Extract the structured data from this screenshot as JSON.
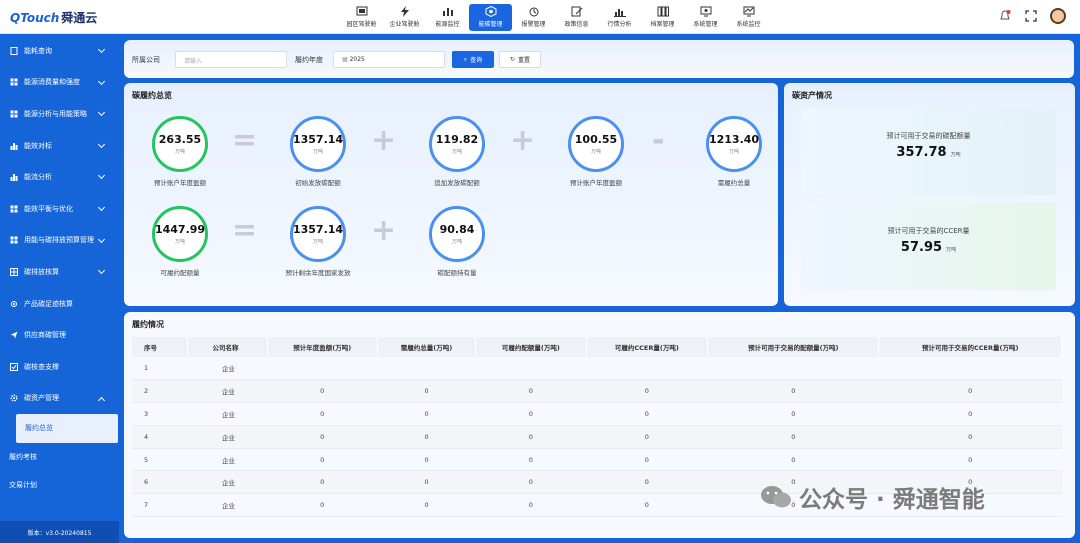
{
  "app": {
    "logo_en": "QTouch",
    "logo_cn": "舜通云"
  },
  "topnav": [
    {
      "label": "园区驾驶舱",
      "icon": "dashboard-icon"
    },
    {
      "label": "企业驾驶舱",
      "icon": "lightning-icon"
    },
    {
      "label": "能源监控",
      "icon": "bar-chart-icon"
    },
    {
      "label": "能碳管理",
      "icon": "carbon-icon"
    },
    {
      "label": "报警管理",
      "icon": "alarm-icon"
    },
    {
      "label": "政策信息",
      "icon": "edit-icon"
    },
    {
      "label": "行情分析",
      "icon": "market-chart-icon"
    },
    {
      "label": "档案管理",
      "icon": "archive-icon"
    },
    {
      "label": "系统管理",
      "icon": "monitor-icon"
    },
    {
      "label": "系统监控",
      "icon": "monitor-chart-icon"
    }
  ],
  "sidebar": {
    "items": [
      {
        "label": "能耗查询"
      },
      {
        "label": "能源消费量和强度"
      },
      {
        "label": "能源分析与用能策略"
      },
      {
        "label": "能效对标"
      },
      {
        "label": "能流分析"
      },
      {
        "label": "能效平衡与优化"
      },
      {
        "label": "用能与碳排放预算管理"
      },
      {
        "label": "碳排放核算"
      },
      {
        "label": "产品碳足迹核算"
      },
      {
        "label": "供应商碳管理"
      },
      {
        "label": "碳核查支撑"
      },
      {
        "label": "碳资产管理"
      }
    ],
    "sub_items": [
      {
        "label": "履约总览"
      },
      {
        "label": "履约考核"
      },
      {
        "label": "交易计划"
      }
    ],
    "version": "版本：v3.0-20240815"
  },
  "filter": {
    "company_label": "所属公司",
    "company_placeholder": "请输入",
    "year_label": "履约年度",
    "year_value": "2025",
    "query_label": "查询",
    "reset_label": "重置"
  },
  "overview": {
    "title": "碳履约总览",
    "unit": "万吨",
    "row1": [
      {
        "value": "263.55",
        "label": "预计账户年度盈额"
      },
      {
        "value": "1357.14",
        "label": "初始发放碳配额"
      },
      {
        "value": "119.82",
        "label": "追加发放碳配额"
      },
      {
        "value": "100.55",
        "label": "预计账户年度盈额"
      },
      {
        "value": "1213.40",
        "label": "需履约总量"
      }
    ],
    "row2": [
      {
        "value": "1447.99",
        "label": "可履约配额量"
      },
      {
        "value": "1357.14",
        "label": "预计剩余年度国家发放"
      },
      {
        "value": "90.84",
        "label": "碳配额持有量"
      }
    ]
  },
  "assets": {
    "title": "碳资产情况",
    "tradable_quota_label": "预计可用于交易的碳配额量",
    "tradable_quota_value": "357.78",
    "tradable_ccer_label": "预计可用于交易的CCER量",
    "tradable_ccer_value": "57.95",
    "unit": "万吨"
  },
  "performance": {
    "title": "履约情况",
    "columns": [
      "序号",
      "公司名称",
      "预计年度盈额(万吨)",
      "需履约总量(万吨)",
      "可履约配额量(万吨)",
      "可履约CCER量(万吨)",
      "预计可用于交易的配额量(万吨)",
      "预计可用于交易的CCER量(万吨)"
    ],
    "rows": [
      [
        "1",
        "企业",
        "",
        "",
        "",
        "",
        "",
        ""
      ],
      [
        "2",
        "企业",
        "0",
        "0",
        "0",
        "0",
        "0",
        "0"
      ],
      [
        "3",
        "企业",
        "0",
        "0",
        "0",
        "0",
        "0",
        "0"
      ],
      [
        "4",
        "企业",
        "0",
        "0",
        "0",
        "0",
        "0",
        "0"
      ],
      [
        "5",
        "企业",
        "0",
        "0",
        "0",
        "0",
        "0",
        "0"
      ],
      [
        "6",
        "企业",
        "0",
        "0",
        "0",
        "0",
        "0",
        "0"
      ],
      [
        "7",
        "企业",
        "0",
        "0",
        "0",
        "0",
        "0",
        "0"
      ]
    ]
  },
  "watermark": {
    "text": "公众号 · 舜通智能"
  },
  "colors": {
    "primary": "#1a66e0",
    "sidebar": "#1565d8",
    "green_ring": "#22c55e",
    "blue_ring": "#4a90f0"
  }
}
